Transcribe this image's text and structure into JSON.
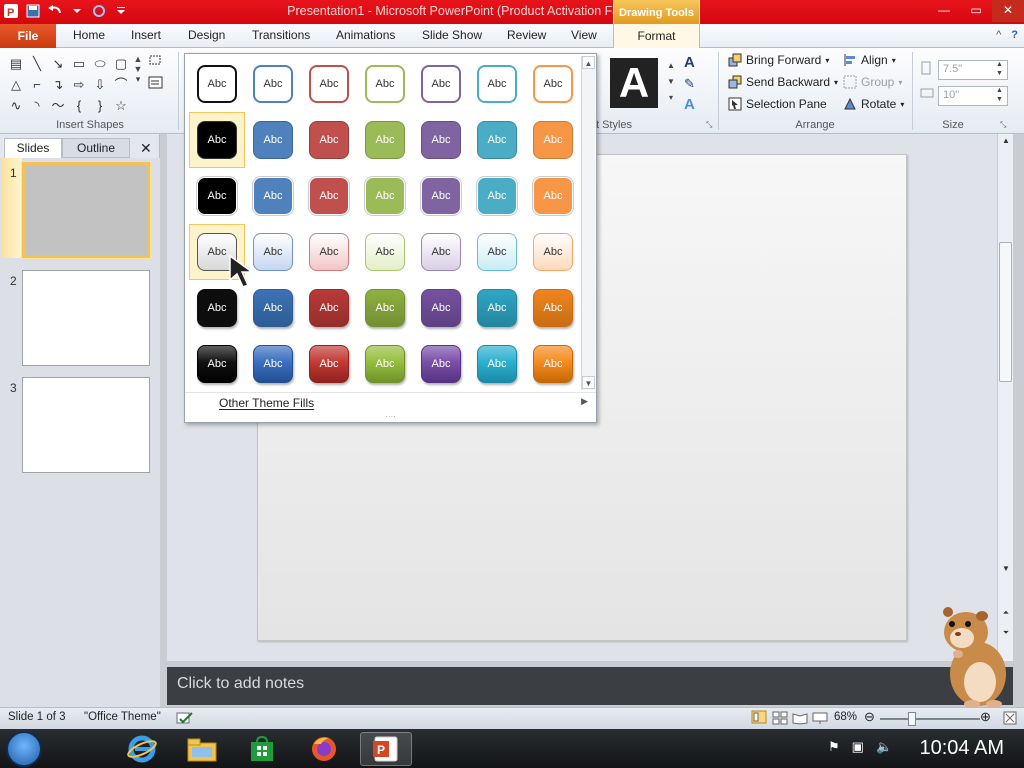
{
  "titlebar": {
    "title": "Presentation1 - Microsoft PowerPoint (Product Activation Failed)",
    "context_tab": "Drawing Tools"
  },
  "tabs": {
    "file": "File",
    "home": "Home",
    "insert": "Insert",
    "design": "Design",
    "transitions": "Transitions",
    "animations": "Animations",
    "slideshow": "Slide Show",
    "review": "Review",
    "view": "View",
    "format": "Format"
  },
  "ribbon": {
    "insert_shapes_label": "Insert Shapes",
    "styles_label": "t Styles",
    "arrange_label": "Arrange",
    "size_label": "Size",
    "bring_forward": "Bring Forward",
    "send_backward": "Send Backward",
    "selection_pane": "Selection Pane",
    "align": "Align",
    "group": "Group",
    "rotate": "Rotate",
    "height_value": "7.5\"",
    "width_value": "10\""
  },
  "pane": {
    "slides_tab": "Slides",
    "outline_tab": "Outline",
    "slide_numbers": [
      "1",
      "2",
      "3"
    ]
  },
  "gallery": {
    "sample_text": "Abc",
    "footer": "Other Theme Fills",
    "rows": [
      {
        "fill": [
          "#ffffff",
          "#ffffff",
          "#ffffff",
          "#ffffff",
          "#ffffff",
          "#ffffff",
          "#ffffff"
        ],
        "outline": [
          "#111111",
          "#4f81bd",
          "#c0504d",
          "#9bbb59",
          "#8064a2",
          "#4bacc6",
          "#f79646"
        ],
        "text": "#333333"
      },
      {
        "fill": [
          "#000000",
          "#4f81bd",
          "#c0504d",
          "#9bbb59",
          "#8064a2",
          "#4bacc6",
          "#f79646"
        ],
        "outline": [
          "#333333",
          "#3a6597",
          "#983d3a",
          "#7b9546",
          "#654f80",
          "#3a8ba1",
          "#c97a39"
        ],
        "text": "#ffffff"
      },
      {
        "fill": [
          "#000000",
          "#4f81bd",
          "#c0504d",
          "#9bbb59",
          "#8064a2",
          "#4bacc6",
          "#f79646"
        ],
        "outline": [
          "#ffffff",
          "#ffffff",
          "#ffffff",
          "#ffffff",
          "#ffffff",
          "#ffffff",
          "#ffffff"
        ],
        "text": "#ffffff"
      },
      {
        "fill": [
          "#d8d8d8",
          "#c5d6f1",
          "#f1c6c5",
          "#e3efc8",
          "#d9cfe6",
          "#c8ecf4",
          "#fdd9bc"
        ],
        "outline": [
          "#555555",
          "#6f93c9",
          "#d17a77",
          "#a9c46f",
          "#9985b9",
          "#66bcd4",
          "#f5a768"
        ],
        "text": "#333333"
      },
      {
        "fill": [
          "#0d0d0d",
          "#3d72b5",
          "#b83b38",
          "#8fb141",
          "#7552a0",
          "#30a6c4",
          "#f0861e"
        ],
        "outline": [
          "#0d0d0d",
          "#2e5d95",
          "#952e2b",
          "#738f34",
          "#5e4182",
          "#24869f",
          "#c96c14"
        ],
        "text": "#ffffff"
      },
      {
        "fill": [
          "#111111",
          "#3a6fc0",
          "#c23a35",
          "#95be3d",
          "#7a4fa8",
          "#2cb0cf",
          "#f68a1f"
        ],
        "outline": [
          "#000000",
          "#234f93",
          "#8f221e",
          "#6f922a",
          "#553381",
          "#1a8aa7",
          "#c46808"
        ],
        "text": "#ffffff"
      }
    ]
  },
  "notes": {
    "placeholder": "Click to add notes"
  },
  "status": {
    "slide_info": "Slide 1 of 3",
    "theme": "\"Office Theme\"",
    "zoom": "68%"
  },
  "taskbar": {
    "clock": "10:04 AM"
  }
}
